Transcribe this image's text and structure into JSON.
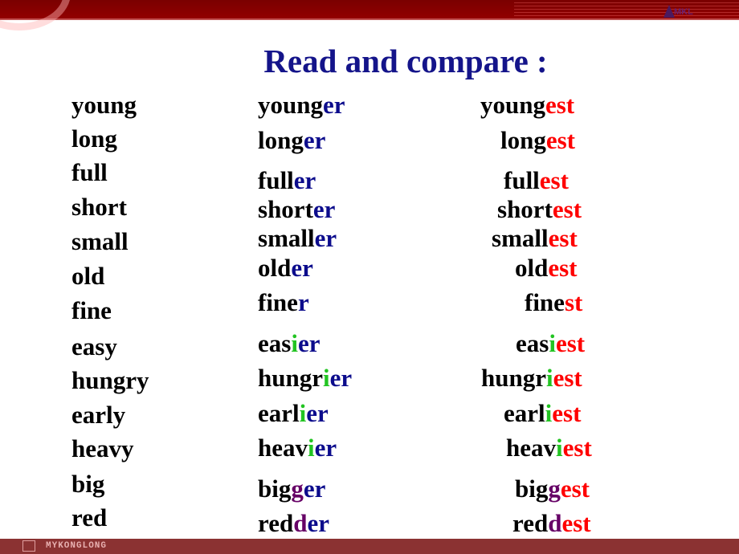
{
  "title": "Read and compare :",
  "brand_top": "MKL",
  "footer_brand": "MYKONGLONG",
  "colors": {
    "k": "#000000",
    "b": "#0c0c8c",
    "g": "#22c422",
    "r": "#ff0000",
    "p": "#660066",
    "title": "#14148a",
    "bar": "#8b0000"
  },
  "rows": [
    {
      "base": "young",
      "comparative": [
        [
          "young",
          "k"
        ],
        [
          "er",
          "b"
        ]
      ],
      "superlative": [
        [
          "young",
          "k"
        ],
        [
          "est",
          "r"
        ]
      ]
    },
    {
      "base": "long",
      "comparative": [
        [
          "long",
          "k"
        ],
        [
          "er",
          "b"
        ]
      ],
      "superlative": [
        [
          "long",
          "k"
        ],
        [
          "est",
          "r"
        ]
      ]
    },
    {
      "base": "full",
      "comparative": [
        [
          "full",
          "k"
        ],
        [
          "er",
          "b"
        ]
      ],
      "superlative": [
        [
          "full",
          "k"
        ],
        [
          "est",
          "r"
        ]
      ]
    },
    {
      "base": "short",
      "comparative": [
        [
          "short",
          "k"
        ],
        [
          "er",
          "b"
        ]
      ],
      "superlative": [
        [
          "short",
          "k"
        ],
        [
          "est",
          "r"
        ]
      ]
    },
    {
      "base": "small",
      "comparative": [
        [
          "small",
          "k"
        ],
        [
          "er",
          "b"
        ]
      ],
      "superlative": [
        [
          "small",
          "k"
        ],
        [
          "est",
          "r"
        ]
      ]
    },
    {
      "base": "old",
      "comparative": [
        [
          "old",
          "k"
        ],
        [
          "er",
          "b"
        ]
      ],
      "superlative": [
        [
          "old",
          "k"
        ],
        [
          "est",
          "r"
        ]
      ]
    },
    {
      "base": "fine",
      "comparative": [
        [
          "fine",
          "k"
        ],
        [
          "r",
          "b"
        ]
      ],
      "superlative": [
        [
          "fine",
          "k"
        ],
        [
          "st",
          "r"
        ]
      ]
    },
    {
      "base": "easy",
      "comparative": [
        [
          "eas",
          "k"
        ],
        [
          "i",
          "g"
        ],
        [
          "er",
          "b"
        ]
      ],
      "superlative": [
        [
          "eas",
          "k"
        ],
        [
          "i",
          "g"
        ],
        [
          "est",
          "r"
        ]
      ]
    },
    {
      "base": "hungry",
      "comparative": [
        [
          "hungr",
          "k"
        ],
        [
          "i",
          "g"
        ],
        [
          "er",
          "b"
        ]
      ],
      "superlative": [
        [
          "hungr",
          "k"
        ],
        [
          "i",
          "g"
        ],
        [
          "est",
          "r"
        ]
      ]
    },
    {
      "base": "early",
      "comparative": [
        [
          "earl",
          "k"
        ],
        [
          "i",
          "g"
        ],
        [
          "er",
          "b"
        ]
      ],
      "superlative": [
        [
          "earl",
          "k"
        ],
        [
          "i",
          "g"
        ],
        [
          "est",
          "r"
        ]
      ]
    },
    {
      "base": "heavy",
      "comparative": [
        [
          "heav",
          "k"
        ],
        [
          "i",
          "g"
        ],
        [
          "er",
          "b"
        ]
      ],
      "superlative": [
        [
          "heav",
          "k"
        ],
        [
          "i",
          "g"
        ],
        [
          "est",
          "r"
        ]
      ]
    },
    {
      "base": "big",
      "comparative": [
        [
          "big",
          "k"
        ],
        [
          "g",
          "p"
        ],
        [
          "er",
          "b"
        ]
      ],
      "superlative": [
        [
          "big",
          "k"
        ],
        [
          "g",
          "p"
        ],
        [
          "est",
          "r"
        ]
      ]
    },
    {
      "base": "red",
      "comparative": [
        [
          "red",
          "k"
        ],
        [
          "d",
          "p"
        ],
        [
          "er",
          "b"
        ]
      ],
      "superlative": [
        [
          "red",
          "k"
        ],
        [
          "d",
          "p"
        ],
        [
          "est",
          "r"
        ]
      ]
    }
  ]
}
